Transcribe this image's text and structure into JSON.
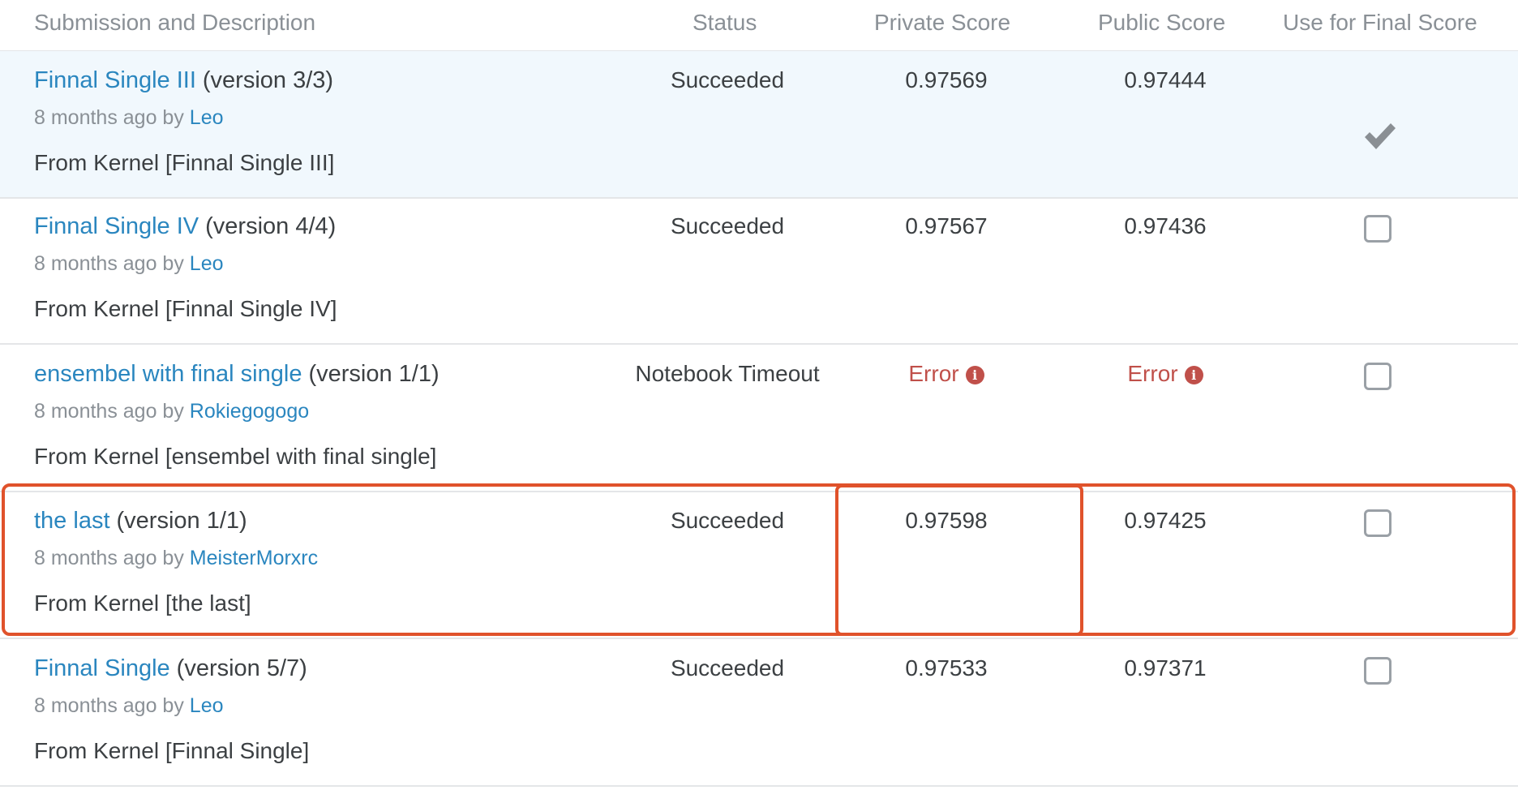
{
  "header": {
    "submission": "Submission and Description",
    "status": "Status",
    "private_score": "Private Score",
    "public_score": "Public Score",
    "use_for_final": "Use for Final Score"
  },
  "rows": [
    {
      "name": "Finnal Single III",
      "version": "(version 3/3)",
      "time": "8 months ago by",
      "author": "Leo",
      "description": "From Kernel [Finnal Single III]",
      "status": "Succeeded",
      "private": "0.97569",
      "public": "0.97444",
      "selected_for_final": true
    },
    {
      "name": "Finnal Single IV",
      "version": "(version 4/4)",
      "time": "8 months ago by",
      "author": "Leo",
      "description": "From Kernel [Finnal Single IV]",
      "status": "Succeeded",
      "private": "0.97567",
      "public": "0.97436",
      "selected_for_final": false
    },
    {
      "name": "ensembel with final single",
      "version": "(version 1/1)",
      "time": "8 months ago by",
      "author": "Rokiegogogo",
      "description": "From Kernel [ensembel with final single]",
      "status": "Notebook Timeout",
      "private": "Error",
      "public": "Error",
      "selected_for_final": false
    },
    {
      "name": "the last",
      "version": "(version 1/1)",
      "time": "8 months ago by",
      "author": "MeisterMorxrc",
      "description": "From Kernel [the last]",
      "status": "Succeeded",
      "private": "0.97598",
      "public": "0.97425",
      "selected_for_final": false
    },
    {
      "name": "Finnal Single",
      "version": "(version 5/7)",
      "time": "8 months ago by",
      "author": "Leo",
      "description": "From Kernel [Finnal Single]",
      "status": "Succeeded",
      "private": "0.97533",
      "public": "0.97371",
      "selected_for_final": false
    }
  ],
  "colors": {
    "link": "#2a86bf",
    "error": "#c0504a",
    "highlight": "#e0522b",
    "selected_row_bg": "#f1f8fd"
  },
  "icons": {
    "error_info": "info-icon",
    "selected": "checkmark-icon",
    "unselected": "checkbox"
  }
}
